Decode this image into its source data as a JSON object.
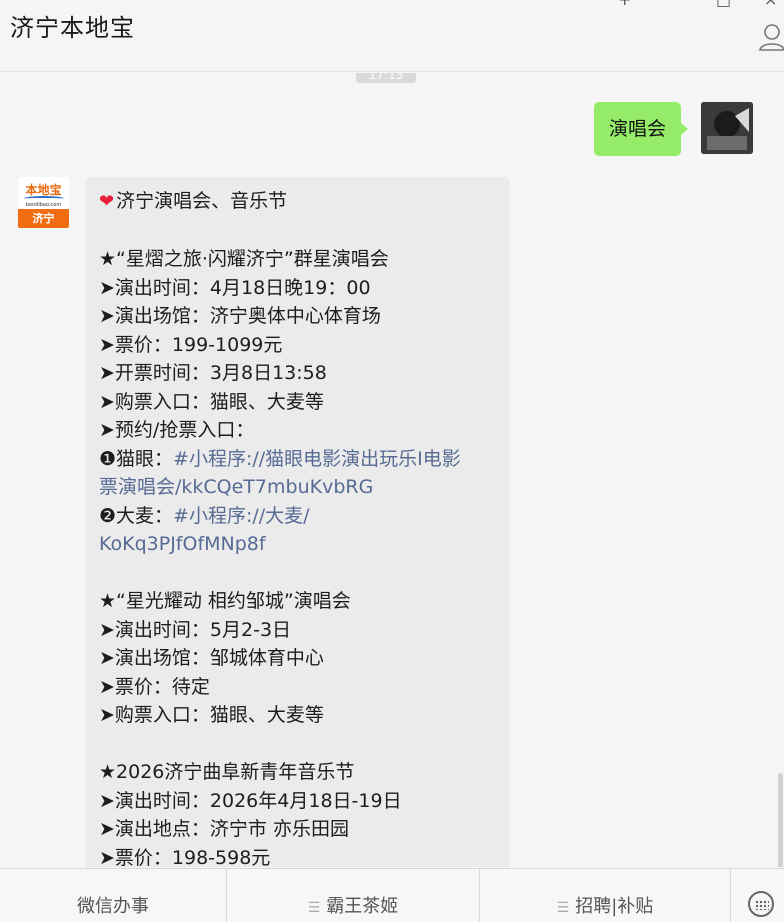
{
  "header": {
    "title": "济宁本地宝"
  },
  "window_controls": {
    "minimize": "+",
    "maximize": "□",
    "close": "×"
  },
  "chat": {
    "timestamp": "17:13",
    "outgoing": {
      "text": "演唱会"
    },
    "incoming": {
      "logo_name": "本地宝",
      "logo_domain": "bendibao.com",
      "logo_city": "济宁",
      "lines": [
        {
          "pre": "",
          "text": "济宁演唱会、音乐节",
          "link": "",
          "heart": true
        },
        {
          "pre": "",
          "text": "",
          "link": ""
        },
        {
          "pre": "",
          "text": "★“星熠之旅·闪耀济宁”群星演唱会",
          "link": ""
        },
        {
          "pre": "",
          "text": "➤演出时间：4月18日晚19：00",
          "link": ""
        },
        {
          "pre": "",
          "text": "➤演出场馆：济宁奥体中心体育场",
          "link": ""
        },
        {
          "pre": "",
          "text": "➤票价：199-1099元",
          "link": ""
        },
        {
          "pre": "",
          "text": "➤开票时间：3月8日13:58",
          "link": ""
        },
        {
          "pre": "",
          "text": "➤购票入口：猫眼、大麦等",
          "link": ""
        },
        {
          "pre": "",
          "text": "➤预约/抢票入口：",
          "link": ""
        },
        {
          "pre": "❶猫眼：",
          "text": "",
          "link": "#小程序://猫眼电影演出玩乐I电影"
        },
        {
          "pre": "",
          "text": "",
          "link": "票演唱会/kkCQeT7mbuKvbRG"
        },
        {
          "pre": "❷大麦：",
          "text": "",
          "link": "#小程序://大麦/"
        },
        {
          "pre": "",
          "text": "",
          "link": "KoKq3PJfOfMNp8f"
        },
        {
          "pre": "",
          "text": "",
          "link": ""
        },
        {
          "pre": "",
          "text": "★“星光耀动 相约邹城”演唱会",
          "link": ""
        },
        {
          "pre": "",
          "text": "➤演出时间：5月2-3日",
          "link": ""
        },
        {
          "pre": "",
          "text": "➤演出场馆：邹城体育中心",
          "link": ""
        },
        {
          "pre": "",
          "text": "➤票价：待定",
          "link": ""
        },
        {
          "pre": "",
          "text": "➤购票入口：猫眼、大麦等",
          "link": ""
        },
        {
          "pre": "",
          "text": "",
          "link": ""
        },
        {
          "pre": "",
          "text": "★2026济宁曲阜新青年音乐节",
          "link": ""
        },
        {
          "pre": "",
          "text": "➤演出时间：2026年4月18日-19日",
          "link": ""
        },
        {
          "pre": "",
          "text": "➤演出地点：济宁市 亦乐田园",
          "link": ""
        },
        {
          "pre": "",
          "text": "➤票价：198-598元",
          "link": ""
        }
      ]
    }
  },
  "menu": {
    "items": [
      "微信办事",
      "霸王茶姬",
      "招聘|补贴"
    ]
  },
  "colors": {
    "outgoing_bubble": "#95ec69",
    "incoming_bubble": "#ebebeb",
    "link": "#576b95",
    "logo_orange": "#f26d12"
  }
}
